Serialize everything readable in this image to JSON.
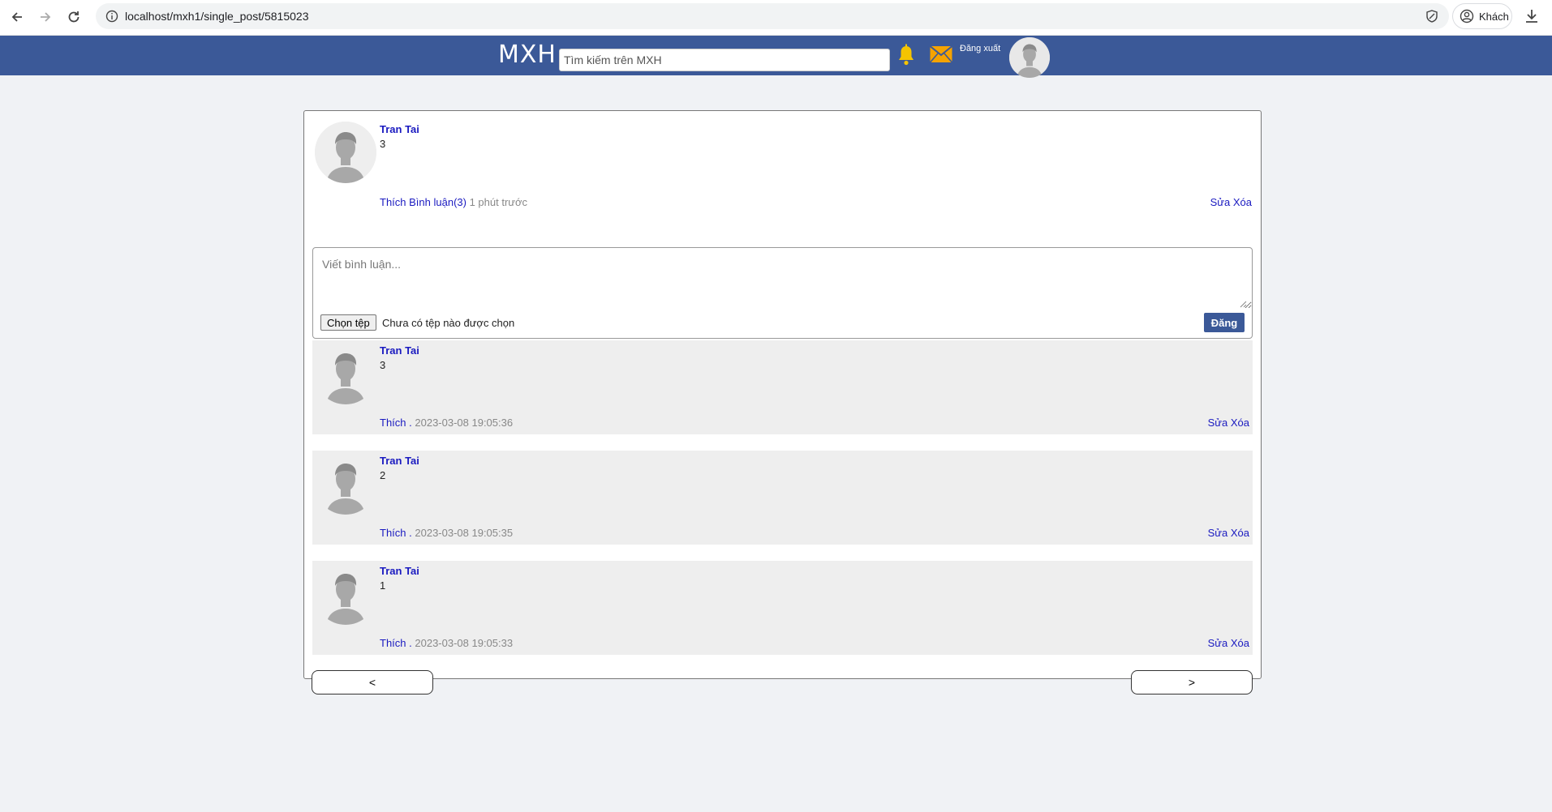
{
  "browser": {
    "url": "localhost/mxh1/single_post/5815023",
    "profile_label": "Khách"
  },
  "header": {
    "brand": "MXH",
    "search_placeholder": "Tìm kiếm trên MXH",
    "logout_label": "Đăng xuất",
    "theme_color": "#3b5998"
  },
  "post": {
    "author": "Tran Tai",
    "content": "3",
    "like_label": "Thích",
    "comment_label": "Bình luận(3)",
    "time": "1 phút trước",
    "edit_label": "Sửa",
    "delete_label": "Xóa"
  },
  "comment_form": {
    "placeholder": "Viết bình luận...",
    "file_button_label": "Chọn tệp",
    "file_status": "Chưa có tệp nào được chọn",
    "submit_label": "Đăng"
  },
  "comments": [
    {
      "author": "Tran Tai",
      "content": "3",
      "like_label": "Thích",
      "separator": " .",
      "timestamp": "2023-03-08 19:05:36",
      "edit_label": "Sửa",
      "delete_label": "Xóa"
    },
    {
      "author": "Tran Tai",
      "content": "2",
      "like_label": "Thích",
      "separator": " .",
      "timestamp": "2023-03-08 19:05:35",
      "edit_label": "Sửa",
      "delete_label": "Xóa"
    },
    {
      "author": "Tran Tai",
      "content": "1",
      "like_label": "Thích",
      "separator": " .",
      "timestamp": "2023-03-08 19:05:33",
      "edit_label": "Sửa",
      "delete_label": "Xóa"
    }
  ],
  "pager": {
    "prev_label": "<",
    "next_label": ">"
  }
}
